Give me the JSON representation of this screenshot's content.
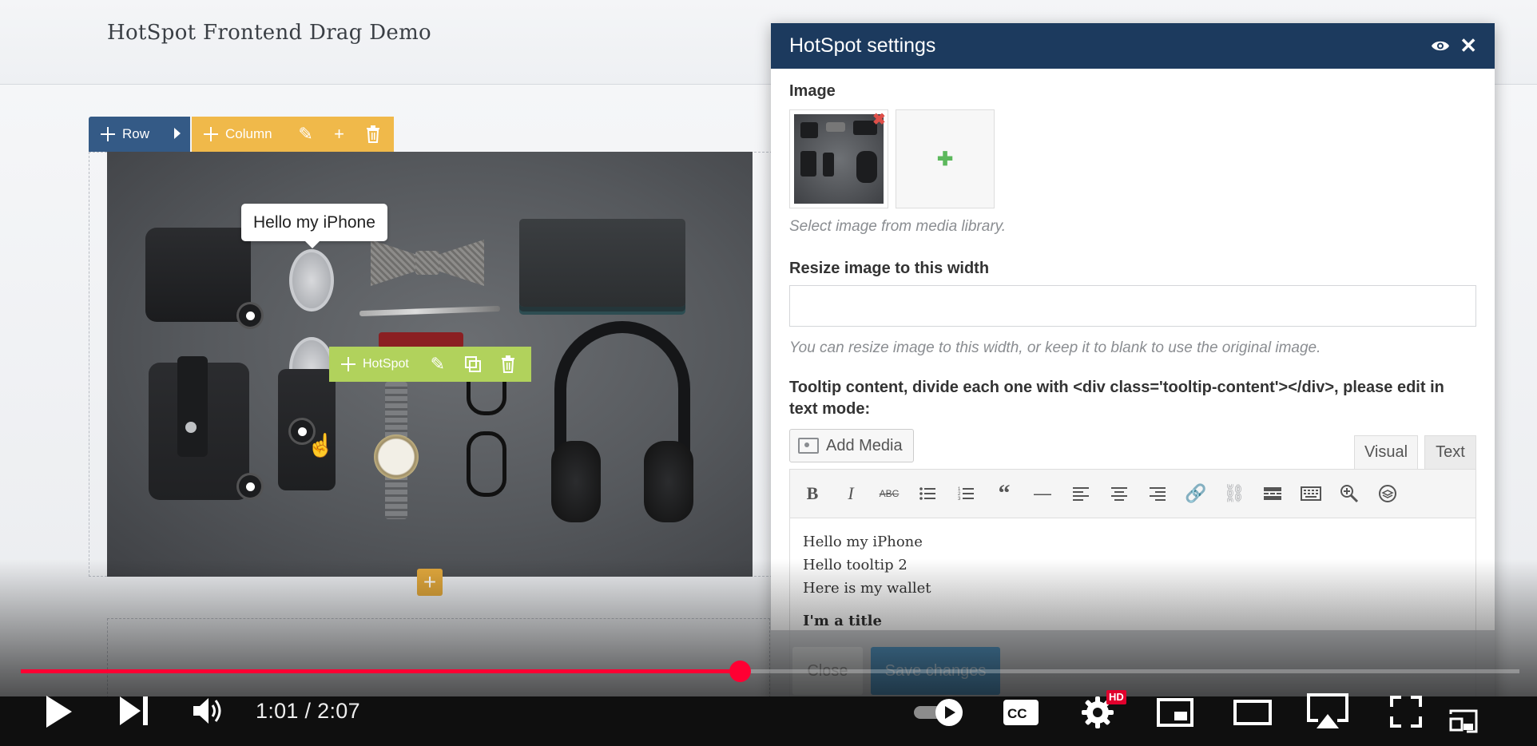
{
  "site": {
    "title": "HotSpot Frontend Drag Demo"
  },
  "builder": {
    "row_label": "Row",
    "column_label": "Column",
    "hotspot_label": "HotSpot",
    "tooltip_text": "Hello my iPhone"
  },
  "modal": {
    "title": "HotSpot settings",
    "image_label": "Image",
    "image_help": "Select image from media library.",
    "resize_label": "Resize image to this width",
    "resize_value": "",
    "resize_help": "You can resize image to this width, or keep it to blank to use the original image.",
    "tooltip_label": "Tooltip content, divide each one with <div class='tooltip-content'></div>, please edit in text mode:",
    "add_media_label": "Add Media",
    "tabs": {
      "visual": "Visual",
      "text": "Text"
    },
    "editor_lines": [
      "Hello my iPhone",
      "Hello tooltip 2",
      "Here is my wallet"
    ],
    "editor_title": "I'm a title",
    "close_label": "Close",
    "save_label": "Save changes"
  },
  "player": {
    "current_time": "1:01",
    "duration": "2:07",
    "time_display": "1:01 / 2:07",
    "progress": 0.48,
    "quality_badge": "HD"
  },
  "colors": {
    "row_bar": "#345a86",
    "column_bar": "#f0b94a",
    "hotspot_bar": "#b1d25c",
    "modal_header": "#1c3a5e",
    "progress": "#ff0033"
  }
}
